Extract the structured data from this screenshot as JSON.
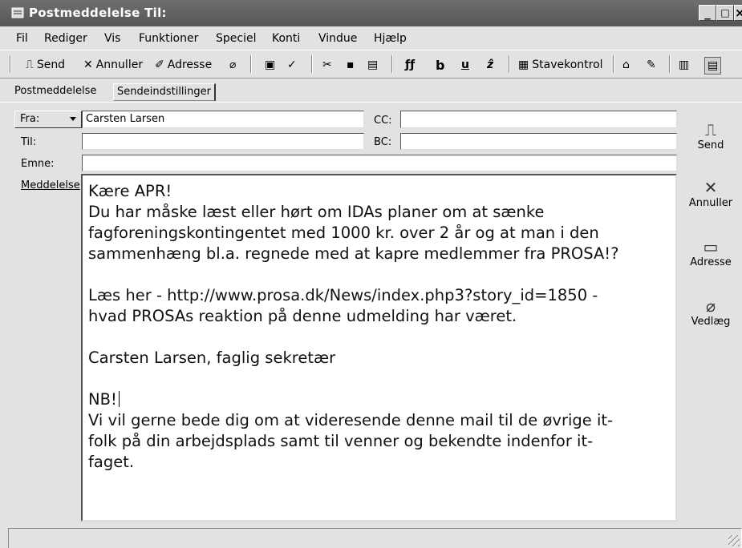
{
  "window": {
    "title": "Postmeddelelse Til:",
    "controls": [
      "_",
      "□",
      "×"
    ]
  },
  "menu": [
    {
      "label": "Fil"
    },
    {
      "label": "Rediger"
    },
    {
      "label": "Vis"
    },
    {
      "label": "Funktioner"
    },
    {
      "label": "Speciel"
    },
    {
      "label": "Konti"
    },
    {
      "label": "Vindue"
    },
    {
      "label": "Hjælp"
    }
  ],
  "toolbar": {
    "send": "Send",
    "cancel": "Annuller",
    "address": "Adresse",
    "spellcheck": "Stavekontrol",
    "bold": "b",
    "underline": "u",
    "italic": "ẑ"
  },
  "tabs": {
    "message": "Postmeddelelse",
    "send_settings": "Sendeindstillinger"
  },
  "form": {
    "from_label": "Fra:",
    "from_value": "Carsten Larsen",
    "to_label": "Til:",
    "to_value": "",
    "subject_label": "Emne:",
    "subject_value": "",
    "cc_label": "CC:",
    "cc_value": "",
    "bc_label": "BC:",
    "bc_value": "",
    "message_label": "Meddelelse"
  },
  "message": {
    "line1": "Kære APR!",
    "line2": "Du har måske læst eller hørt om IDAs planer om at sænke",
    "line3": "fagforeningskontingentet med 1000 kr. over 2 år og at man i den",
    "line4": "sammenhæng bl.a. regnede med at kapre medlemmer fra PROSA!?",
    "line5": "Læs her - http://www.prosa.dk/News/index.php3?story_id=1850 -",
    "line6": "hvad PROSAs reaktion på denne udmelding har været.",
    "line7": "Carsten Larsen, faglig sekretær",
    "line8": "NB!",
    "line9": "Vi vil gerne bede dig om at videresende denne mail til de øvrige it-",
    "line10": "folk på din arbejdsplads samt til venner og bekendte indenfor it-",
    "line11": "faget."
  },
  "sidebar": {
    "send": "Send",
    "cancel": "Annuller",
    "address": "Adresse",
    "attach": "Vedlæg"
  }
}
